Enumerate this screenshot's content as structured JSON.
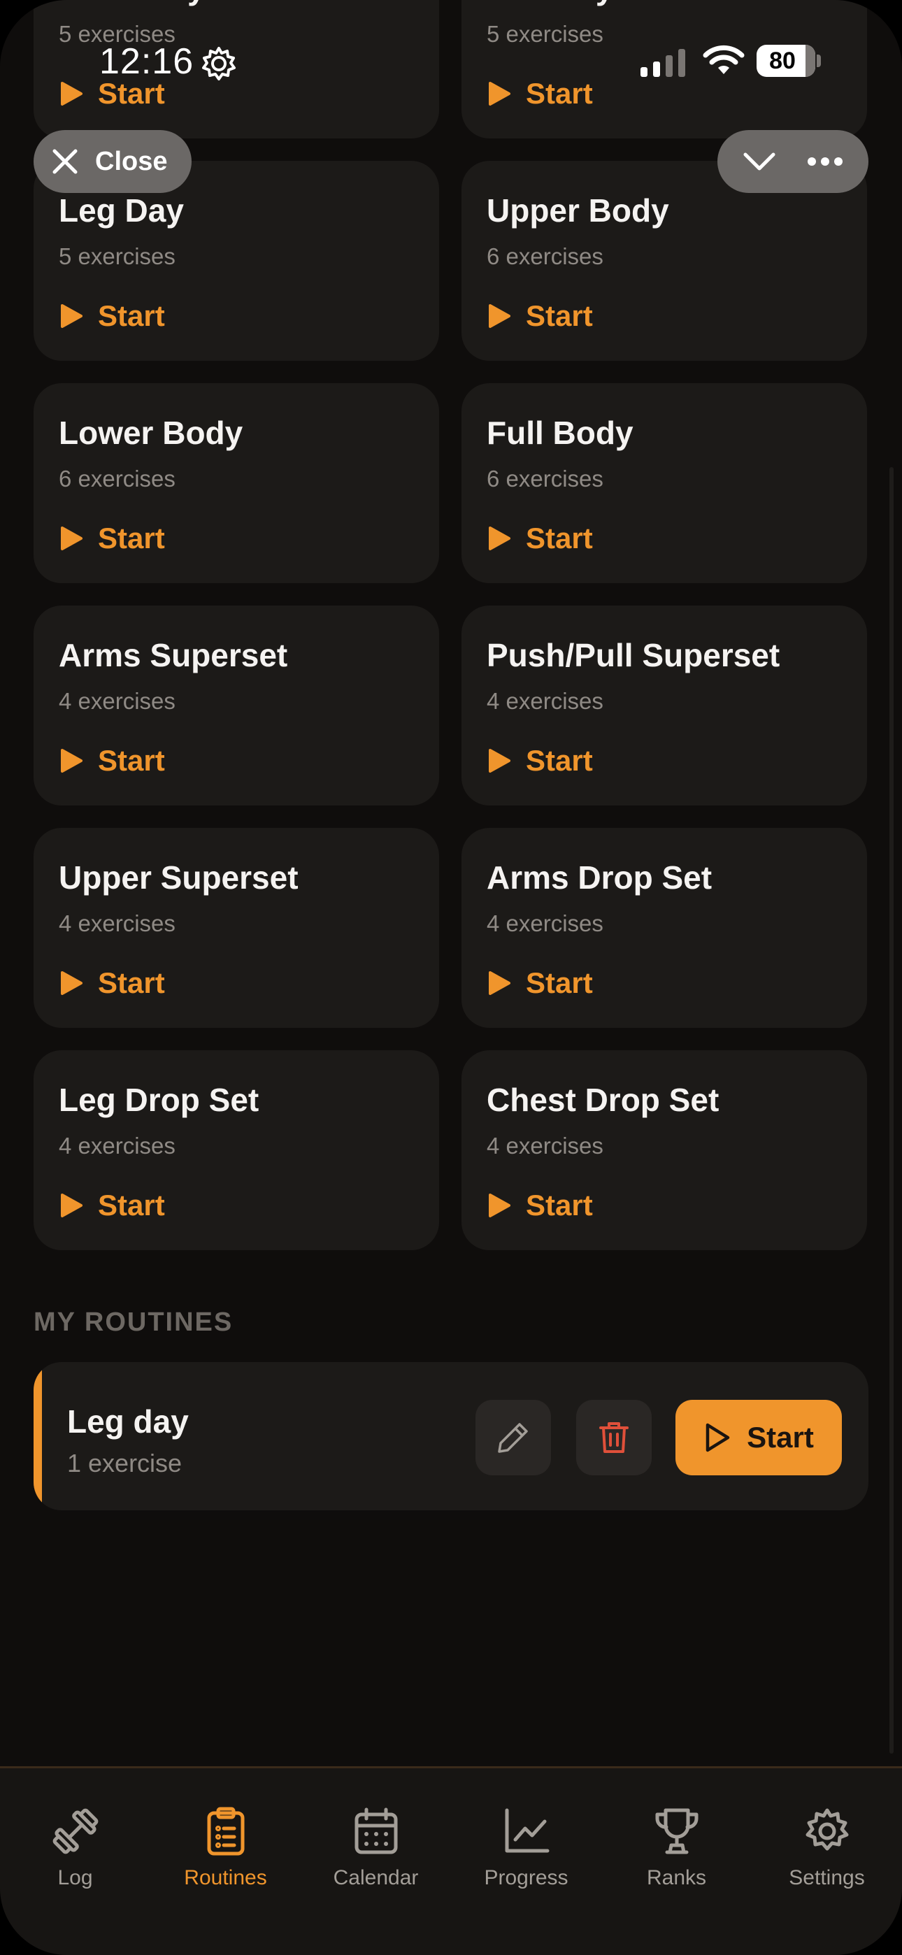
{
  "status": {
    "time": "12:16",
    "battery": "80"
  },
  "top_pills": {
    "close_label": "Close"
  },
  "templates": [
    {
      "title": "Push Day",
      "count": "5 exercises",
      "start": "Start"
    },
    {
      "title": "Pull Day",
      "count": "5 exercises",
      "start": "Start"
    },
    {
      "title": "Leg Day",
      "count": "5 exercises",
      "start": "Start"
    },
    {
      "title": "Upper Body",
      "count": "6 exercises",
      "start": "Start"
    },
    {
      "title": "Lower Body",
      "count": "6 exercises",
      "start": "Start"
    },
    {
      "title": "Full Body",
      "count": "6 exercises",
      "start": "Start"
    },
    {
      "title": "Arms Superset",
      "count": "4 exercises",
      "start": "Start"
    },
    {
      "title": "Push/Pull Superset",
      "count": "4 exercises",
      "start": "Start"
    },
    {
      "title": "Upper Superset",
      "count": "4 exercises",
      "start": "Start"
    },
    {
      "title": "Arms Drop Set",
      "count": "4 exercises",
      "start": "Start"
    },
    {
      "title": "Leg Drop Set",
      "count": "4 exercises",
      "start": "Start"
    },
    {
      "title": "Chest Drop Set",
      "count": "4 exercises",
      "start": "Start"
    }
  ],
  "my_routines": {
    "section_label": "MY ROUTINES",
    "items": [
      {
        "title": "Leg day",
        "count": "1 exercise",
        "start_label": "Start"
      }
    ]
  },
  "tabbar": {
    "tabs": [
      {
        "label": "Log",
        "icon": "dumbbell-icon"
      },
      {
        "label": "Routines",
        "icon": "clipboard-icon",
        "active": true
      },
      {
        "label": "Calendar",
        "icon": "calendar-icon"
      },
      {
        "label": "Progress",
        "icon": "chart-line-icon"
      },
      {
        "label": "Ranks",
        "icon": "trophy-icon"
      },
      {
        "label": "Settings",
        "icon": "gear-icon"
      }
    ]
  },
  "colors": {
    "accent": "#f0952c",
    "background": "#0f0d0c",
    "card": "#1c1a18",
    "delete": "#e0503a"
  }
}
